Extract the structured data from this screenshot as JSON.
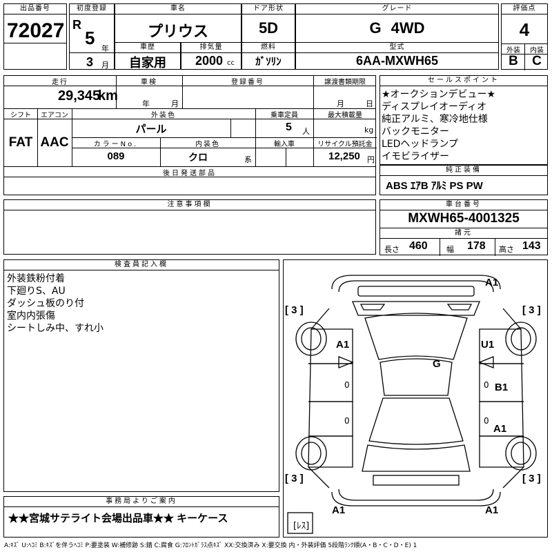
{
  "header": {
    "lot_label": "出品番号",
    "lot": "72027",
    "first_reg_label": "初度登録",
    "era": "R",
    "year": "5",
    "year_unit": "年",
    "month": "3",
    "month_unit": "月",
    "name_label": "車名",
    "name": "プリウス",
    "door_label": "ドア形状",
    "door": "5D",
    "grade_label": "グレード",
    "grade": "G 4WD",
    "score_label": "評価点",
    "score": "4",
    "history_label": "車歴",
    "history": "自家用",
    "displacement_label": "排気量",
    "displacement": "2000",
    "displacement_unit": "cc",
    "fuel_label": "燃料",
    "fuel": "ｶﾞｿﾘﾝ",
    "model_label": "型式",
    "model": "6AA-MXWH65",
    "exterior_label": "外装",
    "exterior": "B",
    "interior_label": "内装",
    "interior": "C"
  },
  "spec": {
    "mileage_label": "走行",
    "mileage": "29,345",
    "mileage_unit": "km",
    "inspection_label": "車検",
    "insp_year_unit": "年",
    "insp_month_unit": "月",
    "regno_label": "登録番号",
    "transfer_label": "譲渡書類期限",
    "transfer_month_unit": "月",
    "transfer_day_unit": "日",
    "shift_label": "シフト",
    "shift": "FAT",
    "ac_label": "エアコン",
    "ac": "AAC",
    "color_label": "外装色",
    "color": "パール",
    "capacity_label": "乗車定員",
    "capacity": "5",
    "capacity_unit": "人",
    "load_label": "最大積載量",
    "load_unit": "kg",
    "colorno_label": "カラーNo.",
    "colorno": "089",
    "intcolor_label": "内装色",
    "intcolor": "クロ",
    "intcolor_unit": "系",
    "import_label": "輸入車",
    "recycle_label": "リサイクル預託金",
    "recycle": "12,250",
    "recycle_unit": "円",
    "later_label": "後日発送部品"
  },
  "sales": {
    "label": "セールスポイント",
    "items": [
      "★オークションデビュー★",
      "ディスプレイオーディオ",
      "純正アルミ、寒冷地仕様",
      "バックモニター",
      "LEDヘッドランプ",
      "イモビライザー"
    ]
  },
  "equip": {
    "label": "純正装備",
    "items": "ABS ｴｱB ｱﾙﾐ PS PW"
  },
  "chassis": {
    "label": "車台番号",
    "value": "MXWH65-4001325"
  },
  "dims": {
    "label": "諸元",
    "length_label": "長さ",
    "length": "460",
    "width_label": "幅",
    "width": "178",
    "height_label": "高さ",
    "height": "143"
  },
  "notes": {
    "label": "注意事項欄"
  },
  "inspector": {
    "label": "検査員記入欄",
    "lines": [
      "外装鉄粉付着",
      "下廻りS、AU",
      "ダッシュ板のり付",
      "室内内張傷",
      "シートしみ中、すれ小"
    ]
  },
  "office": {
    "label": "事務局よりご案内",
    "text": "★★宮城サテライト会場出品車★★ キーケース"
  },
  "diagram": {
    "front_right": "A1",
    "left_front_door": "A1",
    "right_front_door": "U1",
    "roof": "G",
    "right_rear_door": "B1",
    "right_quarter": "A1",
    "rear_left": "A1",
    "rear_right": "A1",
    "tire_fl": "[ 3 ]",
    "tire_fr": "[ 3 ]",
    "tire_rl": "[ 3 ]",
    "tire_rr": "[ 3 ]",
    "spare": "[ﾚｽ]",
    "z1": "0",
    "z2": "0",
    "z3": "0",
    "z4": "0"
  },
  "legend": "A:ｷｽﾞ U:ﾍｺﾐ B:ｷｽﾞを伴うﾍｺﾐ P:要塗装 W:補修跡 S:錆 C:腐食 G:ﾌﾛﾝﾄｶﾞﾗｽ点ｷｽﾞ XX:交換済み X:要交換 内・外装評価 5段階ﾗﾝｸ順(A・B・C・D・E) 1"
}
